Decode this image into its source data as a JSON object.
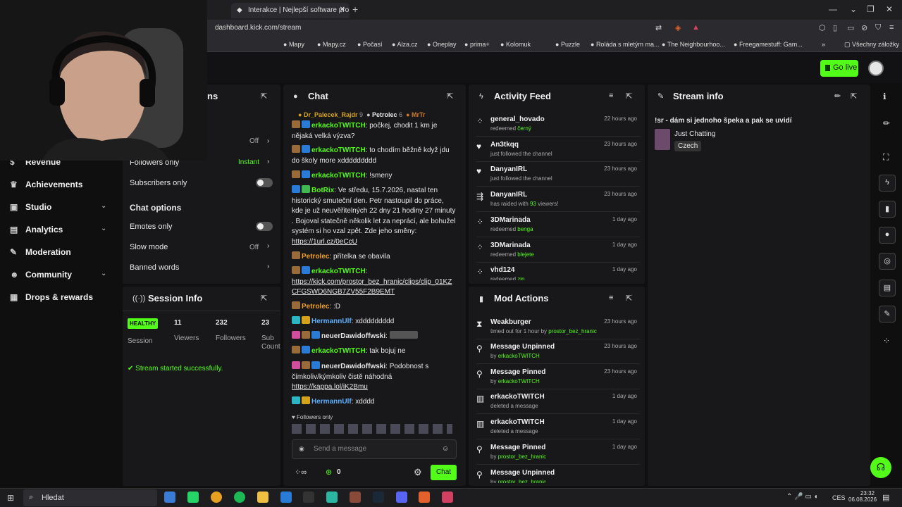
{
  "browser": {
    "tab_title": "Interakce | Nejlepší software pro vyle",
    "url": "dashboard.kick.com/stream",
    "bookmarks": [
      "Mapy",
      "Mapy.cz",
      "Počasí",
      "Alza.cz",
      "Oneplay",
      "prima+",
      "Kolomuk",
      "Puzzle",
      "Roláda s mletým ma...",
      "The Neighbourhoo...",
      "Freegamestuff: Gam...",
      "Všechny záložky"
    ]
  },
  "header": {
    "go_live": "Go live"
  },
  "nav": {
    "items": [
      {
        "label": "Revenue"
      },
      {
        "label": "Achievements"
      },
      {
        "label": "Studio"
      },
      {
        "label": "Analytics"
      },
      {
        "label": "Moderation"
      },
      {
        "label": "Community"
      },
      {
        "label": "Drops & rewards"
      }
    ]
  },
  "chat_settings": {
    "title_partial": "ns",
    "rows": [
      {
        "label": "",
        "value": "Off"
      },
      {
        "label": "Followers only",
        "value": "Instant"
      },
      {
        "label": "Subscribers only",
        "value": ""
      }
    ],
    "options_heading": "Chat options",
    "options": [
      {
        "label": "Emotes only",
        "value": ""
      },
      {
        "label": "Slow mode",
        "value": "Off"
      },
      {
        "label": "Banned words",
        "value": ""
      }
    ]
  },
  "session": {
    "title": "Session Info",
    "health": "HEALTHY",
    "health_label": "Session",
    "viewers": "11",
    "viewers_label": "Viewers",
    "followers": "232",
    "followers_label": "Followers",
    "subs": "23",
    "subs_label": "Sub Count",
    "status": "Stream started successfully."
  },
  "chat": {
    "title": "Chat",
    "top_chatters": [
      {
        "name": "Dr_Palecek_Rajdr",
        "count": "9"
      },
      {
        "name": "Petrolec",
        "count": "6"
      },
      {
        "name": "MrTr",
        "count": ""
      }
    ],
    "messages": [
      {
        "user": "erkackoTWITCH",
        "text": "počkej, chodit 1 km je nějaká velká výzva?",
        "color": "#53fc18"
      },
      {
        "user": "erkackoTWITCH",
        "text": "to chodím běžně když jdu do školy more xddddddddd",
        "color": "#53fc18"
      },
      {
        "user": "erkackoTWITCH",
        "text": "!smeny",
        "color": "#53fc18"
      },
      {
        "user": "BotRix",
        "text": "Ve středu, 15.7.2026, nastal ten historický smuteční den. Petr nastoupil do práce, kde je už neuvěřitelných 22 dny 21 hodiny 27 minuty . Bojoval statečně několik let za neprácí, ale bohužel systém si ho vzal zpět. Zde jeho směny:",
        "link": "https://1url.cz/0eCcU",
        "color": "#53fc18"
      },
      {
        "user": "Petrolec",
        "text": "přítelka se obavila",
        "color": "#f0a020"
      },
      {
        "user": "erkackoTWITCH",
        "text": "",
        "link": "https://kick.com/prostor_bez_hranic/clips/clip_01KZCFGSWD6NGB7ZV55F2B9EMT",
        "color": "#53fc18"
      },
      {
        "user": "Petrolec",
        "text": ":D",
        "color": "#f0a020"
      },
      {
        "user": "HermannUlf",
        "text": "xddddddddd",
        "color": "#5ab0ff"
      },
      {
        "user": "neuerDawidoffwski",
        "text": "",
        "color": "#f0f0f0"
      },
      {
        "user": "erkackoTWITCH",
        "text": "tak bojuj ne",
        "color": "#53fc18"
      },
      {
        "user": "neuerDawidoffwski",
        "text": "Podobnost s čímkoliv/kýmkoliv čistě náhodná",
        "link": "https://kappa.lol/iK2Bmu",
        "color": "#f0f0f0"
      },
      {
        "user": "HermannUlf",
        "text": "xdddd",
        "color": "#5ab0ff"
      }
    ],
    "followers_only": "Followers only",
    "placeholder": "Send a message",
    "points": "0",
    "send": "Chat"
  },
  "activity": {
    "title": "Activity Feed",
    "items": [
      {
        "user": "general_hovado",
        "sub": "redeemed",
        "hl": "černý",
        "time": "22 hours ago",
        "icon": "redeem"
      },
      {
        "user": "An3tkqq",
        "sub": "just followed the channel",
        "hl": "",
        "time": "23 hours ago",
        "icon": "heart"
      },
      {
        "user": "DanyanIRL",
        "sub": "just followed the channel",
        "hl": "",
        "time": "23 hours ago",
        "icon": "heart"
      },
      {
        "user": "DanyanIRL",
        "sub": "has raided with",
        "hl": "93",
        "sub2": "viewers!",
        "time": "23 hours ago",
        "icon": "raid"
      },
      {
        "user": "3DMarinada",
        "sub": "redeemed",
        "hl": "benga",
        "time": "1 day ago",
        "icon": "redeem"
      },
      {
        "user": "3DMarinada",
        "sub": "redeemed",
        "hl": "blejete",
        "time": "1 day ago",
        "icon": "redeem"
      },
      {
        "user": "vhd124",
        "sub": "redeemed",
        "hl": "zip",
        "time": "1 day ago",
        "icon": "redeem"
      }
    ]
  },
  "mod_actions": {
    "title": "Mod Actions",
    "items": [
      {
        "user": "Weakburger",
        "sub": "timed out for 1 hour by",
        "hl": "prostor_bez_hranic",
        "time": "23 hours ago",
        "icon": "hourglass"
      },
      {
        "user": "Message Unpinned",
        "sub": "by",
        "hl": "erkackoTWITCH",
        "time": "23 hours ago",
        "icon": "unpin"
      },
      {
        "user": "Message Pinned",
        "sub": "by",
        "hl": "erkackoTWITCH",
        "time": "23 hours ago",
        "icon": "pin"
      },
      {
        "user": "erkackoTWITCH",
        "sub": "deleted a message",
        "hl": "",
        "time": "1 day ago",
        "icon": "trash"
      },
      {
        "user": "erkackoTWITCH",
        "sub": "deleted a message",
        "hl": "",
        "time": "1 day ago",
        "icon": "trash"
      },
      {
        "user": "Message Pinned",
        "sub": "by",
        "hl": "prostor_bez_hranic",
        "time": "1 day ago",
        "icon": "pin"
      },
      {
        "user": "Message Unpinned",
        "sub": "by",
        "hl": "prostor_bez_hranic",
        "time": "",
        "icon": "unpin"
      }
    ]
  },
  "stream_info": {
    "title": "Stream info",
    "stream_title": "!sr - dám si jednoho špeka a pak se uvidí",
    "category": "Just Chatting",
    "language": "Czech"
  },
  "taskbar": {
    "search": "Hledat",
    "lang": "CES",
    "time": "23:32",
    "date": "06.08.2026"
  },
  "colors": {
    "accent": "#53fc18",
    "panel": "#18181a",
    "bg": "#0f0f10"
  }
}
